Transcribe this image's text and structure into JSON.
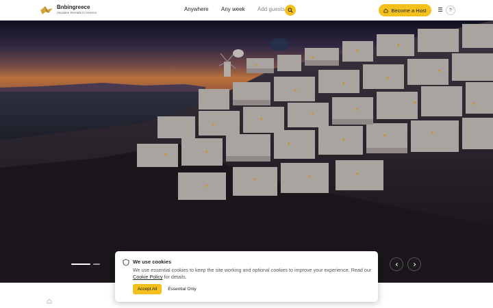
{
  "brand": {
    "name": "Bnbingreece",
    "tagline": "Vacation Rentals in Greece",
    "logo": "golden-bird-logo"
  },
  "nav": {
    "anywhere": "Anywhere",
    "any_week": "Any week",
    "add_guests": "Add guests",
    "search_icon": "search-icon"
  },
  "header_right": {
    "become_host": "Become a Host",
    "host_icon": "home-icon",
    "menu_icon": "menu-icon",
    "help": "?"
  },
  "hero": {
    "image": "santorini-oia-night-village",
    "carousel": {
      "active_slide": 1,
      "slide_count": 2
    },
    "prev_icon": "chevron-left-icon",
    "next_icon": "chevron-right-icon"
  },
  "cookie": {
    "title": "We use cookies",
    "text_before": "We use essential cookies to keep the site working and optional cookies to improve your experience. Read our ",
    "link": "Cookie Policy",
    "text_after": " for details.",
    "accept": "Accept All",
    "essential": "Essential Only",
    "icon": "shield-icon"
  },
  "colors": {
    "accent": "#f3c01c",
    "sky_top": "#15152a",
    "sky_glow": "#e08a4a",
    "sea": "#24293b"
  }
}
